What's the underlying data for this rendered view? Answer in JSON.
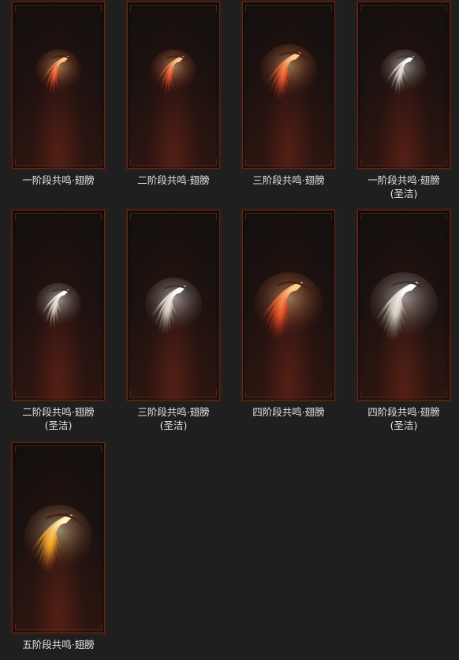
{
  "items": [
    {
      "name": "一阶段共鸣·翅膀",
      "sub": "",
      "wing": "fire",
      "size": "small"
    },
    {
      "name": "二阶段共鸣·翅膀",
      "sub": "",
      "wing": "fire",
      "size": "small"
    },
    {
      "name": "三阶段共鸣·翅膀",
      "sub": "",
      "wing": "fire",
      "size": "medium"
    },
    {
      "name": "一阶段共鸣·翅膀",
      "sub": "(圣洁)",
      "wing": "holy",
      "size": "small"
    },
    {
      "name": "二阶段共鸣·翅膀",
      "sub": "(圣洁)",
      "wing": "holy",
      "size": "small"
    },
    {
      "name": "三阶段共鸣·翅膀",
      "sub": "(圣洁)",
      "wing": "holy",
      "size": "medium"
    },
    {
      "name": "四阶段共鸣·翅膀",
      "sub": "",
      "wing": "fire",
      "size": "large"
    },
    {
      "name": "四阶段共鸣·翅膀",
      "sub": "(圣洁)",
      "wing": "holy",
      "size": "large"
    },
    {
      "name": "五阶段共鸣·翅膀",
      "sub": "",
      "wing": "gold",
      "size": "large"
    }
  ],
  "colors": {
    "fire": [
      "#ffcf8a",
      "#e8552a",
      "#8a1f10"
    ],
    "holy": [
      "#ffffff",
      "#d8d2c2",
      "#6b6356"
    ],
    "gold": [
      "#fff3c0",
      "#f0a020",
      "#7a3a10"
    ]
  }
}
